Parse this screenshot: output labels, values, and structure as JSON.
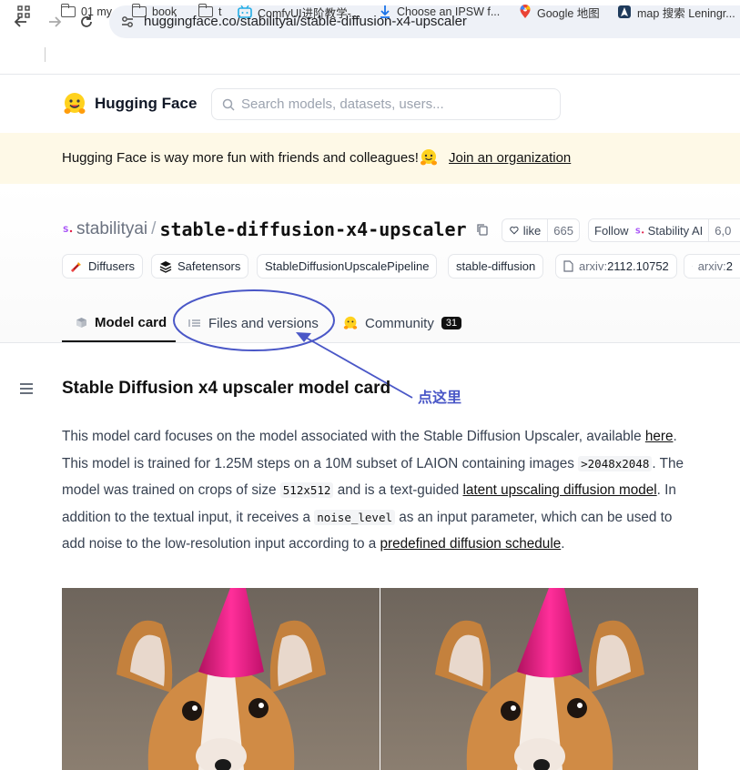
{
  "browser": {
    "url": "huggingface.co/stabilityai/stable-diffusion-x4-upscaler",
    "bookmarks": [
      {
        "label": "01 my",
        "icon": "folder-icon"
      },
      {
        "label": "book",
        "icon": "folder-icon"
      },
      {
        "label": "t",
        "icon": "folder-icon"
      },
      {
        "label": "ComfyUI进阶教学-...",
        "icon": "bilibili-icon"
      },
      {
        "label": "Choose an IPSW f...",
        "icon": "download-icon"
      },
      {
        "label": "Google 地图",
        "icon": "maps-pin-icon"
      },
      {
        "label": "map 搜索 Leningr...",
        "icon": "map-icon"
      }
    ]
  },
  "header": {
    "logo_text": "Hugging Face",
    "search_placeholder": "Search models, datasets, users..."
  },
  "banner": {
    "text": "Hugging Face is way more fun with friends and colleagues!",
    "link": "Join an organization"
  },
  "repo": {
    "org": "stabilityai",
    "separator": "/",
    "name": "stable-diffusion-x4-upscaler",
    "like_label": "like",
    "like_count": "665",
    "follow_label": "Follow",
    "follow_org": "Stability AI",
    "follow_count": "6,0",
    "tags": [
      {
        "label": "Diffusers",
        "icon": "diffusers-icon"
      },
      {
        "label": "Safetensors",
        "icon": "safetensors-icon"
      },
      {
        "label": "StableDiffusionUpscalePipeline",
        "icon": ""
      },
      {
        "label": "stable-diffusion",
        "icon": ""
      },
      {
        "prefix": "arxiv:",
        "label": "2112.10752",
        "icon": "file-icon"
      },
      {
        "prefix": "arxiv:",
        "label": "2",
        "icon": "file-icon"
      }
    ]
  },
  "tabs": [
    {
      "label": "Model card",
      "icon": "cube-icon",
      "active": true
    },
    {
      "label": "Files and versions",
      "icon": "files-icon"
    },
    {
      "label": "Community",
      "icon": "hugging-emoji-icon",
      "badge": "31"
    }
  ],
  "annotation": {
    "label": "点这里",
    "color": "#4a57c7"
  },
  "content": {
    "heading": "Stable Diffusion x4 upscaler model card",
    "p1_a": "This model card focuses on the model associated with the Stable Diffusion Upscaler, available ",
    "p1_link": "here",
    "p1_b": ". This model is trained for 1.25M steps on a 10M subset of LAION containing images ",
    "code1": ">2048x2048",
    "p1_c": ". The model was trained on crops of size ",
    "code2": "512x512",
    "p1_d": " and is a text-guided ",
    "link2": "latent upscaling diffusion model",
    "p1_e": ". In addition to the textual input, it receives a ",
    "code3": "noise_level",
    "p1_f": " as an input parameter, which can be used to add noise to the low-resolution input according to a ",
    "link3": "predefined diffusion schedule",
    "p1_g": "."
  },
  "colors": {
    "banner_bg": "#fef9e7",
    "accent": "#4a57c7",
    "hat": "#e8157d"
  }
}
